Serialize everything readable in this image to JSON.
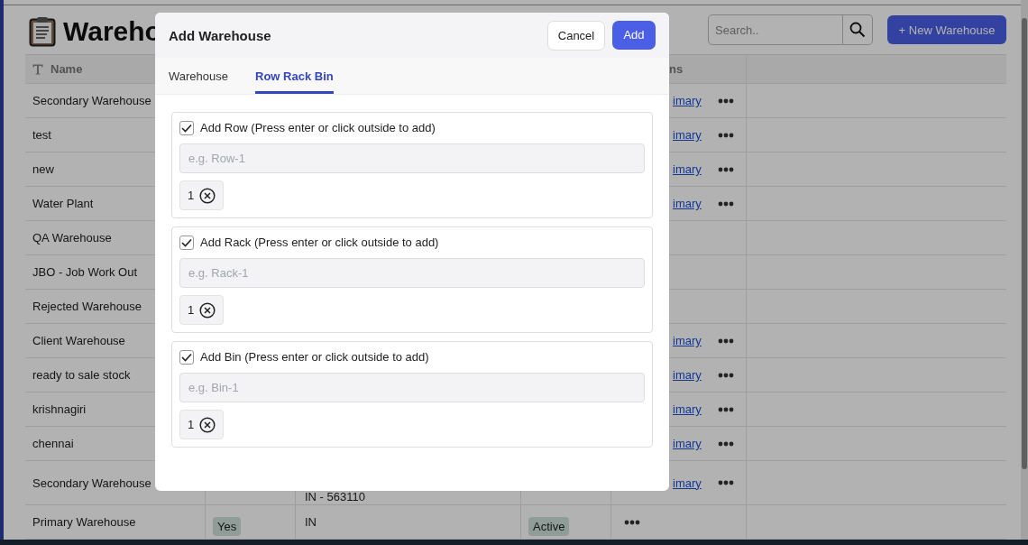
{
  "page": {
    "title": "Wareho",
    "search": {
      "placeholder": "Search.."
    },
    "new_button": "+ New Warehouse"
  },
  "table": {
    "name_header": "Name",
    "actions_header": "ns",
    "rows": [
      {
        "name": "Secondary Warehouse",
        "link": "imary",
        "menu": true
      },
      {
        "name": "test",
        "link": "imary",
        "menu": true
      },
      {
        "name": "new",
        "link": "imary",
        "menu": true
      },
      {
        "name": "Water Plant",
        "link": "imary",
        "menu": true
      },
      {
        "name": "QA Warehouse",
        "menu": false
      },
      {
        "name": "JBO - Job Work Out",
        "menu": false
      },
      {
        "name": "Rejected Warehouse",
        "menu": false
      },
      {
        "name": "Client Warehouse",
        "link": "imary",
        "menu": true
      },
      {
        "name": "ready to sale stock",
        "link": "imary",
        "menu": true
      },
      {
        "name": "krishnagiri",
        "link": "imary",
        "menu": true
      },
      {
        "name": "chennai",
        "link": "imary",
        "menu": true
      },
      {
        "name": "Secondary Warehouse",
        "location": "IN - 563110",
        "link": "imary",
        "menu": true
      },
      {
        "name": "Primary Warehouse",
        "default": "Yes",
        "location": "IN",
        "status": "Active",
        "menu": true
      }
    ]
  },
  "modal": {
    "title": "Add Warehouse",
    "cancel": "Cancel",
    "add": "Add",
    "tabs": [
      {
        "label": "Warehouse",
        "selected": false
      },
      {
        "label": "Row Rack Bin",
        "selected": true
      }
    ],
    "sections": [
      {
        "label": "Add Row (Press enter or click outside to add)",
        "checked": true,
        "placeholder": "e.g. Row-1",
        "chips": [
          "1"
        ]
      },
      {
        "label": "Add Rack (Press enter or click outside to add)",
        "checked": true,
        "placeholder": "e.g. Rack-1",
        "chips": [
          "1"
        ]
      },
      {
        "label": "Add Bin (Press enter or click outside to add)",
        "checked": true,
        "placeholder": "e.g. Bin-1",
        "chips": [
          "1"
        ]
      }
    ]
  }
}
